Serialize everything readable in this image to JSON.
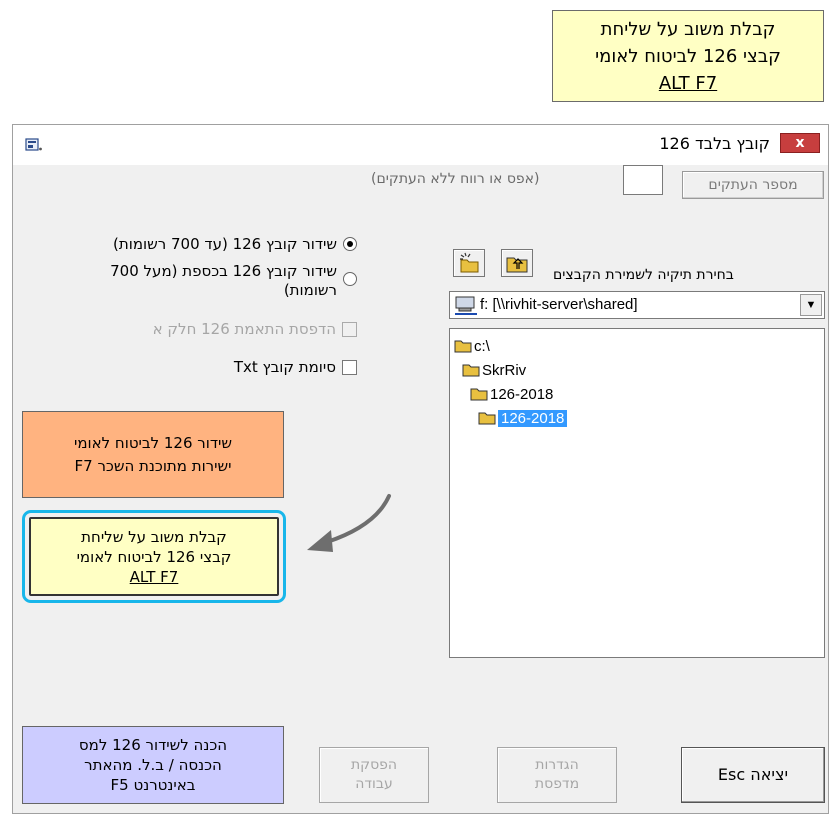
{
  "callout": {
    "line1": "קבלת משוב על שליחת",
    "line2": "קבצי 126 לביטוח לאומי",
    "line3": "ALT F7"
  },
  "window": {
    "title": "קובץ בלבד 126",
    "close_label": "x"
  },
  "copies": {
    "button_label": "מספר העתקים",
    "input_value": "",
    "hint": "(אפס או רווח ללא העתקים)"
  },
  "transmit_options": [
    {
      "label": "שידור קובץ 126 (עד 700 רשומות)",
      "checked": true
    },
    {
      "label": "שידור קובץ 126 בכספת (מעל 700",
      "label2": "רשומות)",
      "checked": false
    }
  ],
  "checkboxes": [
    {
      "label": "הדפסת התאמת 126 חלק א",
      "enabled": false,
      "checked": false
    },
    {
      "label": "סיומת קובץ Txt",
      "enabled": true,
      "checked": false
    }
  ],
  "folder_picker": {
    "label": "בחירת תיקיה לשמירת הקבצים",
    "drive": "f: [\\\\rivhit-server\\shared]",
    "folders": [
      "c:\\",
      "SkrRiv",
      "126-2018",
      "126-2018"
    ],
    "selected_index": 3
  },
  "buttons": {
    "transmit_direct": {
      "line1": "שידור 126 לביטוח לאומי",
      "line2": "ישירות מתוכנת השכר F7"
    },
    "feedback": {
      "line1": "קבלת משוב על שליחת",
      "line2": "קבצי 126 לביטוח לאומי",
      "line3": "ALT F7"
    },
    "prepare_tax": {
      "line1": "הכנה לשידור 126 למס",
      "line2": "הכנסה / ב.ל. מהאתר",
      "line3": "באינטרנט F5"
    },
    "stop_job": {
      "line1": "הפסקת",
      "line2": "עבודה"
    },
    "printer_settings": {
      "line1": "הגדרות",
      "line2": "מדפסת"
    },
    "exit": "יציאה Esc"
  },
  "colors": {
    "callout_bg": "#ffffc4",
    "orange_button": "#ffb380",
    "purple_button": "#ccccff",
    "highlight_ring": "#18b6ea",
    "selection": "#3399ff",
    "close_red": "#c73e3e"
  }
}
